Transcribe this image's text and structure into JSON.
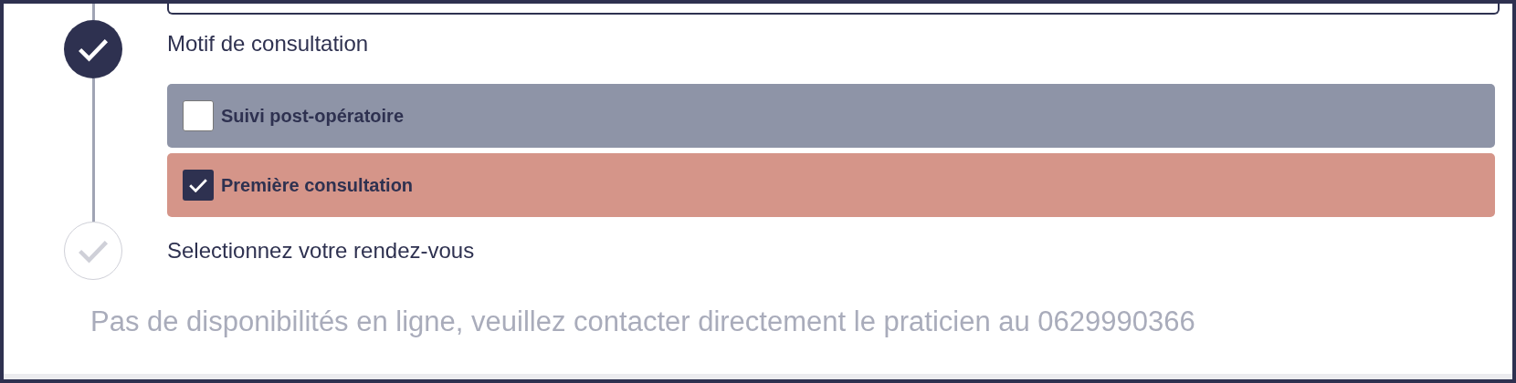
{
  "steps": [
    {
      "title": "Motif de consultation",
      "done": true,
      "options": [
        {
          "label": "Suivi post-opératoire",
          "checked": false
        },
        {
          "label": "Première consultation",
          "checked": true
        }
      ]
    },
    {
      "title": "Selectionnez votre rendez-vous",
      "done": false
    }
  ],
  "notice": "Pas de disponibilités en ligne, veuillez contacter directement le praticien au 0629990366"
}
